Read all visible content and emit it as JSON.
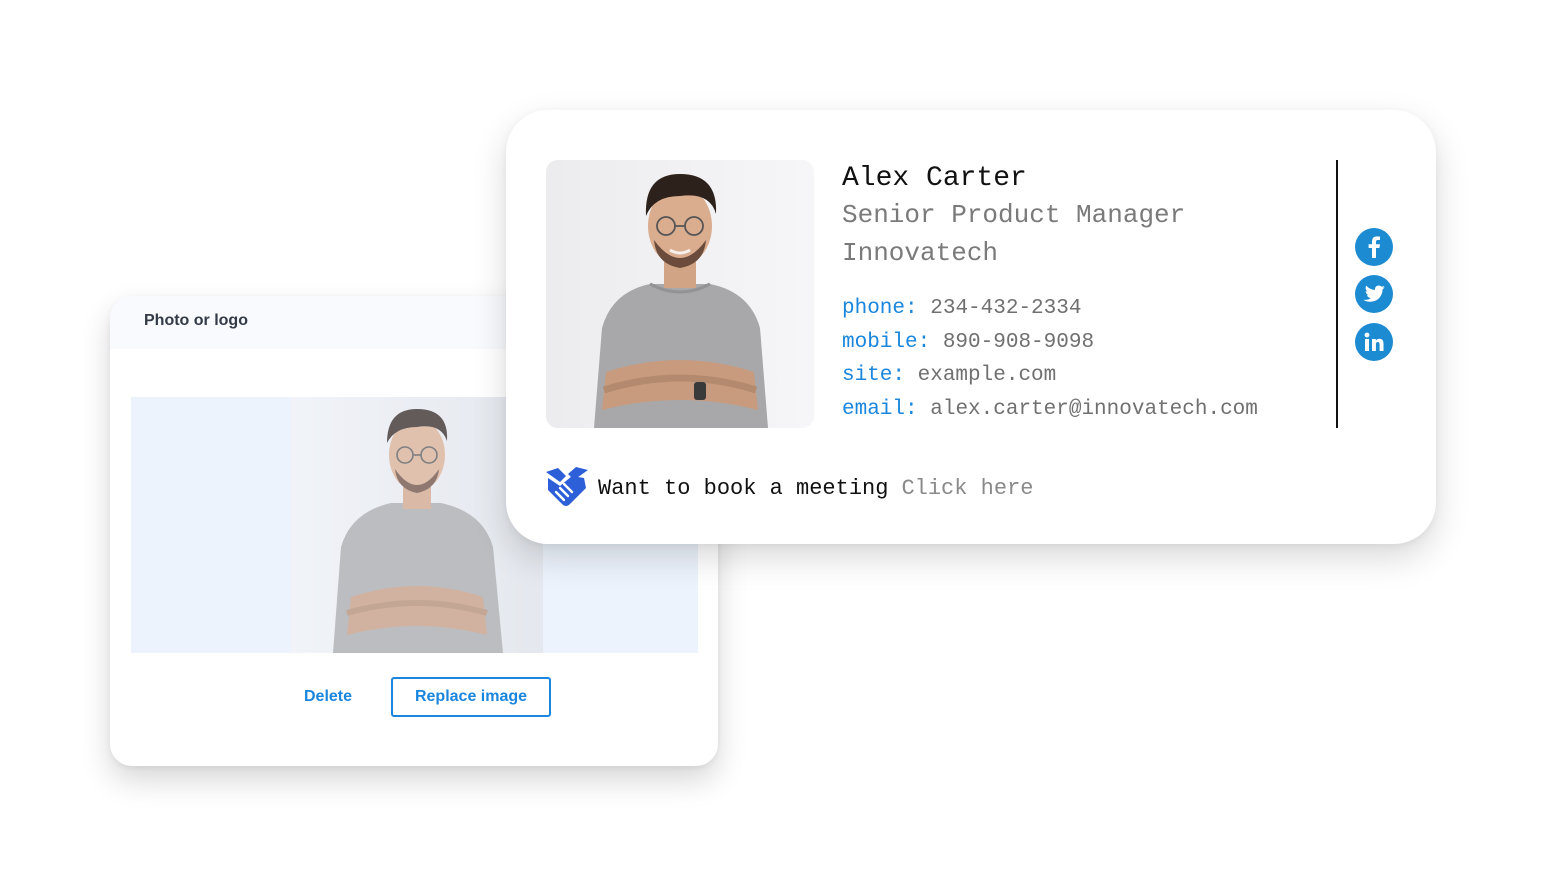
{
  "photo_panel": {
    "title": "Photo or logo",
    "delete_label": "Delete",
    "replace_label": "Replace image"
  },
  "signature": {
    "name": "Alex Carter",
    "role": "Senior Product Manager",
    "company": "Innovatech",
    "contacts": [
      {
        "label": "phone:",
        "value": "234-432-2334"
      },
      {
        "label": "mobile:",
        "value": "890-908-9098"
      },
      {
        "label": "site:",
        "value": "example.com"
      },
      {
        "label": "email:",
        "value": "alex.carter@innovatech.com"
      }
    ],
    "social": [
      "facebook-icon",
      "twitter-icon",
      "linkedin-icon"
    ],
    "meeting_text": "Want to book a meeting",
    "meeting_link": "Click here"
  },
  "colors": {
    "accent": "#1a86de",
    "social": "#1d8bd1",
    "meeting_icon": "#2d5fd8"
  }
}
